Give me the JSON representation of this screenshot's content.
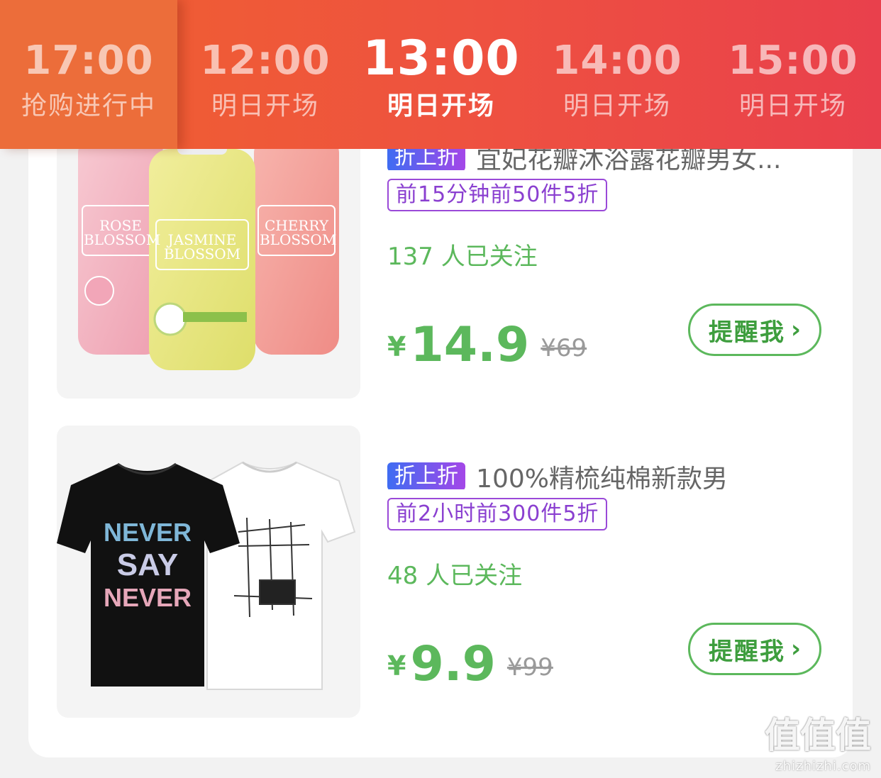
{
  "tabs": [
    {
      "time": "17:00",
      "status": "抢购进行中"
    },
    {
      "time": "12:00",
      "status": "明日开场"
    },
    {
      "time": "13:00",
      "status": "明日开场"
    },
    {
      "time": "14:00",
      "status": "明日开场"
    },
    {
      "time": "15:00",
      "status": "明日开场"
    }
  ],
  "items": [
    {
      "badge": "折上折",
      "title": "宜妃花瓣沐浴露花瓣男女...",
      "promo": "前15分钟前50件5折",
      "follow": "137 人已关注",
      "yen": "¥",
      "price": "14.9",
      "orig": "¥69",
      "remind": "提醒我",
      "thumb_icon": "shower-gel-bottles-image",
      "bottles": [
        {
          "line1": "ROSE",
          "line2": "BLOSSOM"
        },
        {
          "line1": "JASMINE",
          "line2": "BLOSSOM"
        },
        {
          "line1": "CHERRY",
          "line2": "BLOSSOM"
        }
      ]
    },
    {
      "badge": "折上折",
      "title": "100%精梳纯棉新款男",
      "promo": "前2小时前300件5折",
      "follow": "48 人已关注",
      "yen": "¥",
      "price": "9.9",
      "orig": "¥99",
      "remind": "提醒我",
      "thumb_icon": "tshirts-image",
      "shirt_text": [
        "NEVER",
        "SAY",
        "NEVER"
      ]
    }
  ],
  "watermark": {
    "logo": "值值值",
    "url": "zhizhizhi.com"
  },
  "colors": {
    "accent_green": "#5cb85c",
    "tab_orange": "#f0622f",
    "tab_red": "#e9404c",
    "promo_purple": "#8a3fd0"
  }
}
